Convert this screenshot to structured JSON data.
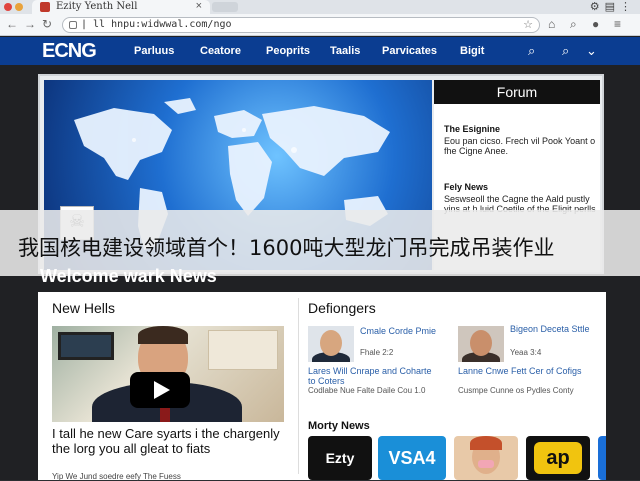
{
  "browser": {
    "tab_title": "Ezity Yenth Nell",
    "tab_close": "×",
    "url": "| ll hnpu:widwwal.com/ngo",
    "back": "←",
    "forward": "→",
    "reload": "↻"
  },
  "site": {
    "logo": "ECNG",
    "nav": [
      "Parluus",
      "Ceatore",
      "Peoprits",
      "Taalis",
      "Parvicates",
      "Bigit"
    ]
  },
  "forum": {
    "title": "Forum",
    "item1_title": "The Esignine",
    "item1_text": "Eou pan cicso. Frech vil Pook Yoant o fhe Cigne Anee.",
    "item2_title": "Fely News",
    "item2_text": "Seswseoll the Cagne the Aald pustly yins at h luid Coetile of the Eligit perlls"
  },
  "overlay_caption": "我国核电建设领域首个！1600吨大型龙门吊完成吊装作业",
  "section_title": "Welcome wark News",
  "left_col": {
    "title": "New Hells",
    "headline": "I tall he new Care syarts i the chargenly the lorg you all gleat to fiats",
    "sub": "Yip We Jund soedre eefy The Fuess"
  },
  "right_col": {
    "title": "Defiongers",
    "items": [
      {
        "title": "Cmale Corde Pmie",
        "sub": "Fhale 2:2"
      },
      {
        "title": "Bigeon Deceta Sttle",
        "sub": "Yeaa 3:4"
      }
    ],
    "body_left": "Lares Will Cnrape and Coharte to Coters",
    "body_left_sub": "Codlabe Nue Falte Daile Cou 1.0",
    "body_right": "Lanne Cnwe Fett Cer of Cofigs",
    "body_right_sub": "Cusmpe Cunne os Pydles Conty",
    "more_title": "Morty News",
    "badges": [
      "Ezty",
      "VSA4",
      "",
      "ap"
    ]
  },
  "colors": {
    "brand_nav": "#0b3d91",
    "forum_head": "#111111",
    "link": "#2a5fa8"
  }
}
